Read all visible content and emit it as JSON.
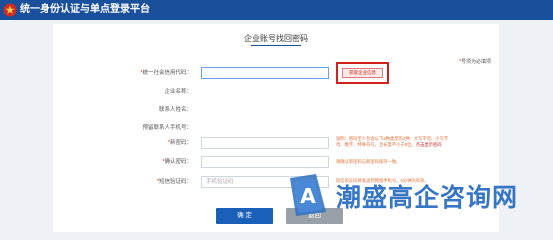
{
  "header": {
    "app_title": "统一身份认证与单点登录平台",
    "logo_icon": "emblem-icon"
  },
  "form": {
    "page_title": "企业账号找回密码",
    "required_note": "号项为必填项",
    "fields": {
      "credit_code": {
        "label": "统一社会信用代码：",
        "value": "",
        "required": true
      },
      "company_name": {
        "label": "企业名称："
      },
      "contact_name": {
        "label": "联系人姓名："
      },
      "reserved_phone": {
        "label": "预留联系人手机号："
      },
      "new_password": {
        "label": "新密码：",
        "required": true
      },
      "confirm_password": {
        "label": "确认密码：",
        "required": true
      },
      "sms_code": {
        "label": "短信验证码：",
        "required": true,
        "placeholder": "手机验证码"
      }
    },
    "fetch_button": "获取企业信息",
    "hints": {
      "password_rule_1": "说明：密码至少包含以下3种类型的2种：大写字母、小写字",
      "password_rule_2": "母、数字、特殊符号，且长度不小于8位。",
      "password_rule_link": "点击显示密码",
      "confirm_rule": "请确认新密码与新密码保持一致。",
      "sms_rule": "短信验证码将发送到预留手机号，5分钟内有效。"
    },
    "buttons": {
      "confirm": "确 定",
      "return": "返回"
    }
  },
  "watermark": {
    "text": "潮盛高企咨询网",
    "color": "#2c6fc2"
  },
  "colors": {
    "header": "#1a4f9c",
    "primary": "#1a5fb8",
    "alert": "#d0221a"
  }
}
